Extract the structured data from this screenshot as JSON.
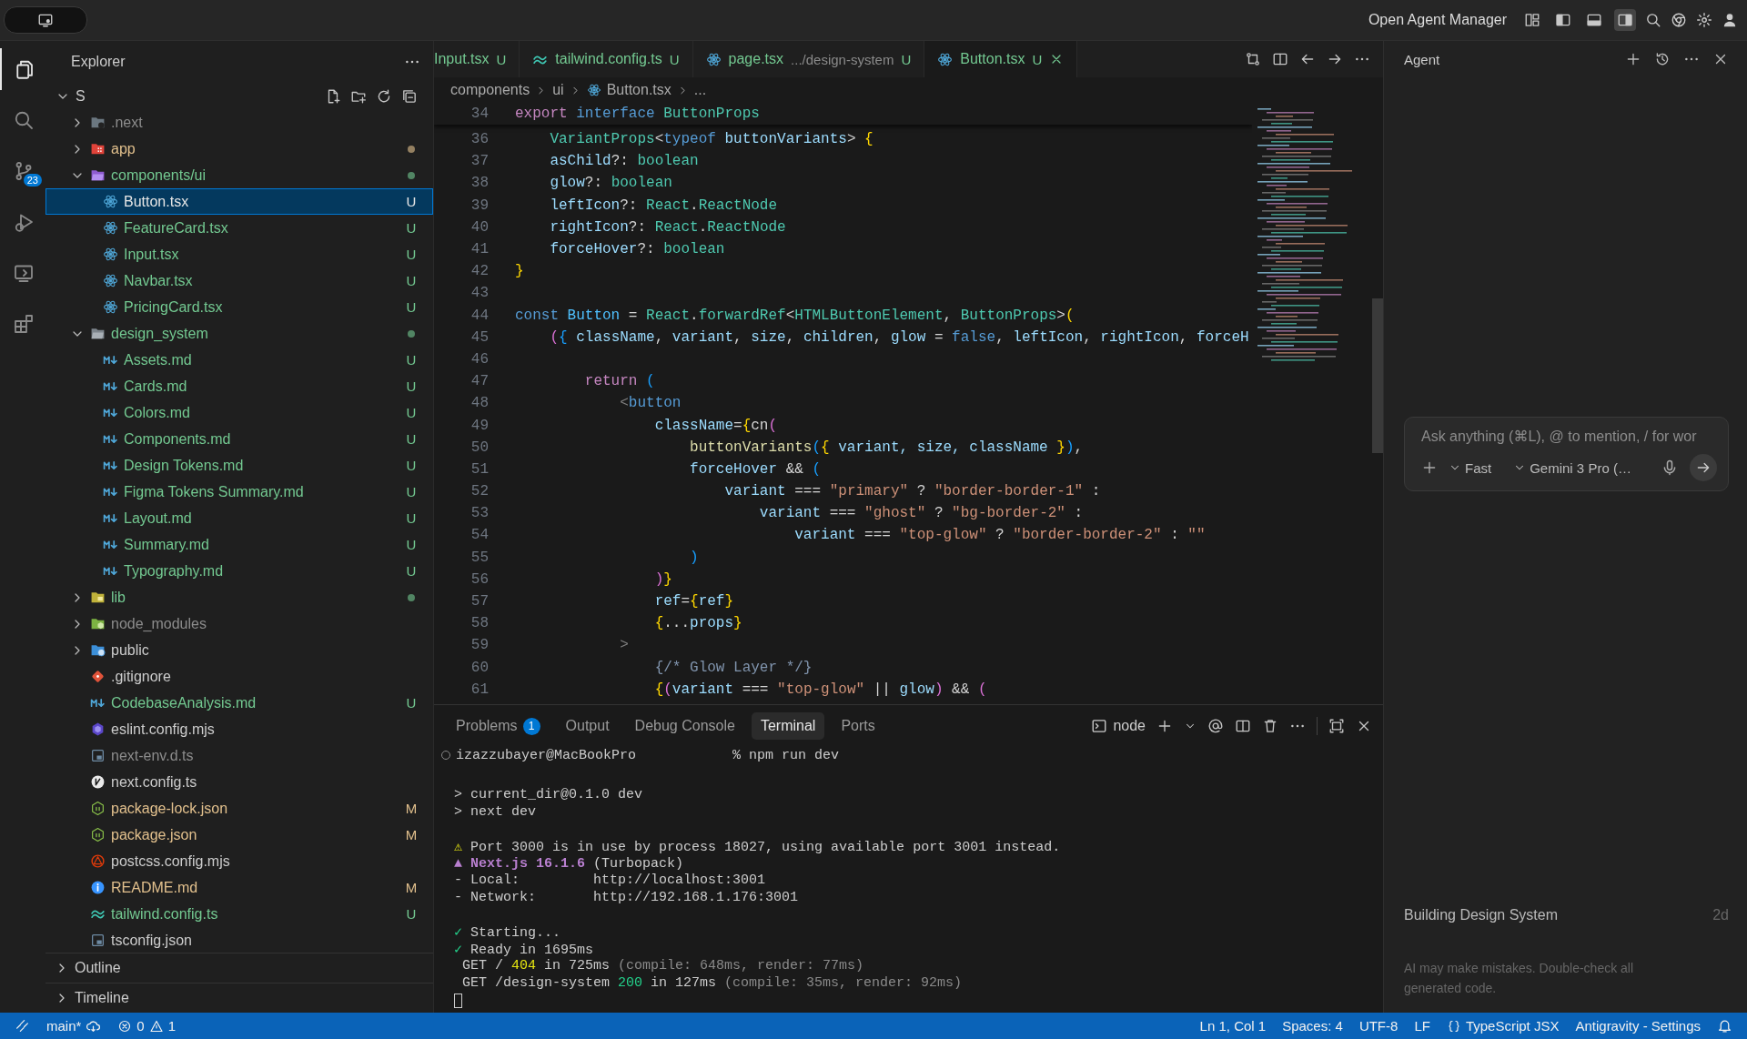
{
  "top_bar": {
    "agent_manager": "Open Agent Manager",
    "toggles": [
      {
        "kind": "customize",
        "selected": false
      },
      {
        "kind": "left-sidebar",
        "selected": false
      },
      {
        "kind": "panel",
        "selected": false
      },
      {
        "kind": "right-sidebar",
        "selected": true
      }
    ]
  },
  "activity_bar": [
    {
      "kind": "files",
      "selected": true
    },
    {
      "kind": "search",
      "selected": false
    },
    {
      "kind": "source-control",
      "selected": false,
      "badge": "23"
    },
    {
      "kind": "run",
      "selected": false
    },
    {
      "kind": "remote",
      "selected": false
    },
    {
      "kind": "extensions",
      "selected": false
    }
  ],
  "explorer": {
    "title": "Explorer",
    "root": {
      "name": "S",
      "kind": "root",
      "color": "#cccccc",
      "expanded": true,
      "selected": false,
      "children": [
        {
          "name": ".next",
          "kind": "nextfolder",
          "color": "#8c8c8c",
          "expanded": false,
          "selected": false
        },
        {
          "name": "app",
          "kind": "appfolder",
          "color": "#e2c08d",
          "dot": true,
          "expanded": false,
          "selected": false
        },
        {
          "name": "components/ui",
          "kind": "componentsfolder",
          "color": "#73c991",
          "dot": true,
          "expanded": true,
          "selected": false,
          "children": [
            {
              "name": "Button.tsx",
              "kind": "react",
              "color": "#e6e6e6",
              "badge": "U",
              "selected": true
            },
            {
              "name": "FeatureCard.tsx",
              "kind": "react",
              "color": "#73c991",
              "badge": "U",
              "selected": false
            },
            {
              "name": "Input.tsx",
              "kind": "react",
              "color": "#73c991",
              "badge": "U",
              "selected": false
            },
            {
              "name": "Navbar.tsx",
              "kind": "react",
              "color": "#73c991",
              "badge": "U",
              "selected": false
            },
            {
              "name": "PricingCard.tsx",
              "kind": "react",
              "color": "#73c991",
              "badge": "U",
              "selected": false
            }
          ]
        },
        {
          "name": "design_system",
          "kind": "plainfolder",
          "color": "#73c991",
          "dot": true,
          "expanded": true,
          "selected": false,
          "children": [
            {
              "name": "Assets.md",
              "kind": "markdown",
              "color": "#73c991",
              "badge": "U",
              "selected": false
            },
            {
              "name": "Cards.md",
              "kind": "markdown",
              "color": "#73c991",
              "badge": "U",
              "selected": false
            },
            {
              "name": "Colors.md",
              "kind": "markdown",
              "color": "#73c991",
              "badge": "U",
              "selected": false
            },
            {
              "name": "Components.md",
              "kind": "markdown",
              "color": "#73c991",
              "badge": "U",
              "selected": false
            },
            {
              "name": "Design Tokens.md",
              "kind": "markdown",
              "color": "#73c991",
              "badge": "U",
              "selected": false
            },
            {
              "name": "Figma Tokens Summary.md",
              "kind": "markdown",
              "color": "#73c991",
              "badge": "U",
              "selected": false
            },
            {
              "name": "Layout.md",
              "kind": "markdown",
              "color": "#73c991",
              "badge": "U",
              "selected": false
            },
            {
              "name": "Summary.md",
              "kind": "markdown",
              "color": "#73c991",
              "badge": "U",
              "selected": false
            },
            {
              "name": "Typography.md",
              "kind": "markdown",
              "color": "#73c991",
              "badge": "U",
              "selected": false
            }
          ]
        },
        {
          "name": "lib",
          "kind": "libfolder",
          "color": "#73c991",
          "dot": true,
          "expanded": false,
          "selected": false
        },
        {
          "name": "node_modules",
          "kind": "modulesfolder",
          "color": "#8c8c8c",
          "expanded": false,
          "selected": false
        },
        {
          "name": "public",
          "kind": "publicfolder",
          "color": "#cccccc",
          "expanded": false,
          "selected": false
        },
        {
          "name": ".gitignore",
          "kind": "git",
          "color": "#cccccc",
          "selected": false
        },
        {
          "name": "CodebaseAnalysis.md",
          "kind": "markdown",
          "color": "#73c991",
          "badge": "U",
          "selected": false
        },
        {
          "name": "eslint.config.mjs",
          "kind": "eslint",
          "color": "#cccccc",
          "selected": false
        },
        {
          "name": "next-env.d.ts",
          "kind": "typescript",
          "color": "#8c8c8c",
          "selected": false
        },
        {
          "name": "next.config.ts",
          "kind": "nextjs",
          "color": "#cccccc",
          "selected": false
        },
        {
          "name": "package-lock.json",
          "kind": "json",
          "color": "#e2c08d",
          "badge": "M",
          "selected": false
        },
        {
          "name": "package.json",
          "kind": "json",
          "color": "#e2c08d",
          "badge": "M",
          "selected": false
        },
        {
          "name": "postcss.config.mjs",
          "kind": "postcss",
          "color": "#cccccc",
          "selected": false
        },
        {
          "name": "README.md",
          "kind": "info",
          "color": "#e2c08d",
          "badge": "M",
          "selected": false
        },
        {
          "name": "tailwind.config.ts",
          "kind": "tailwind",
          "color": "#73c991",
          "badge": "U",
          "selected": false
        },
        {
          "name": "tsconfig.json",
          "kind": "typescript",
          "color": "#cccccc",
          "selected": false
        }
      ]
    },
    "sections": [
      {
        "label": "Outline",
        "expanded": false
      },
      {
        "label": "Timeline",
        "expanded": false
      }
    ]
  },
  "editor": {
    "tabs": [
      {
        "label": "Input.tsx",
        "kind": "hidden",
        "badge": "U",
        "selected": false
      },
      {
        "label": "tailwind.config.ts",
        "kind": "tailwind",
        "badge": "U",
        "selected": false
      },
      {
        "label": "page.tsx",
        "kind": "react",
        "description": ".../design-system",
        "badge": "U",
        "selected": false
      },
      {
        "label": "Button.tsx",
        "kind": "react",
        "badge": "U",
        "selected": true
      }
    ],
    "breadcrumb": [
      {
        "label": "components",
        "kind": "folder"
      },
      {
        "label": "ui",
        "kind": "folder"
      },
      {
        "label": "Button.tsx",
        "kind": "react"
      },
      {
        "label": "...",
        "kind": "symbol"
      }
    ],
    "sticky_line": {
      "number": "34",
      "tokens": [
        {
          "text": "export ",
          "kind": "keyword"
        },
        {
          "text": "interface ",
          "kind": "storage"
        },
        {
          "text": "ButtonProps",
          "kind": "type"
        }
      ]
    },
    "lines": [
      {
        "number": "36",
        "tokens": [
          {
            "text": "    VariantProps",
            "kind": "type"
          },
          {
            "text": "<",
            "kind": "plain"
          },
          {
            "text": "typeof ",
            "kind": "storage"
          },
          {
            "text": "buttonVariants",
            "kind": "variable"
          },
          {
            "text": "> ",
            "kind": "plain"
          },
          {
            "text": "{",
            "kind": "bracket1"
          }
        ]
      },
      {
        "number": "37",
        "tokens": [
          {
            "text": "    asChild",
            "kind": "variable"
          },
          {
            "text": "?: ",
            "kind": "plain"
          },
          {
            "text": "boolean",
            "kind": "type"
          }
        ]
      },
      {
        "number": "38",
        "tokens": [
          {
            "text": "    glow",
            "kind": "variable"
          },
          {
            "text": "?: ",
            "kind": "plain"
          },
          {
            "text": "boolean",
            "kind": "type"
          }
        ]
      },
      {
        "number": "39",
        "tokens": [
          {
            "text": "    leftIcon",
            "kind": "variable"
          },
          {
            "text": "?: ",
            "kind": "plain"
          },
          {
            "text": "React",
            "kind": "type"
          },
          {
            "text": ".",
            "kind": "plain"
          },
          {
            "text": "ReactNode",
            "kind": "type"
          }
        ]
      },
      {
        "number": "40",
        "tokens": [
          {
            "text": "    rightIcon",
            "kind": "variable"
          },
          {
            "text": "?: ",
            "kind": "plain"
          },
          {
            "text": "React",
            "kind": "type"
          },
          {
            "text": ".",
            "kind": "plain"
          },
          {
            "text": "ReactNode",
            "kind": "type"
          }
        ]
      },
      {
        "number": "41",
        "tokens": [
          {
            "text": "    forceHover",
            "kind": "variable"
          },
          {
            "text": "?: ",
            "kind": "plain"
          },
          {
            "text": "boolean",
            "kind": "type"
          }
        ]
      },
      {
        "number": "42",
        "tokens": [
          {
            "text": "}",
            "kind": "bracket1"
          }
        ]
      },
      {
        "number": "43"
      },
      {
        "number": "44",
        "tokens": [
          {
            "text": "const ",
            "kind": "storage"
          },
          {
            "text": "Button",
            "kind": "constant"
          },
          {
            "text": " = ",
            "kind": "plain"
          },
          {
            "text": "React",
            "kind": "type"
          },
          {
            "text": ".",
            "kind": "plain"
          },
          {
            "text": "forwardRef",
            "kind": "type"
          },
          {
            "text": "<",
            "kind": "plain"
          },
          {
            "text": "HTMLButtonElement",
            "kind": "type"
          },
          {
            "text": ", ",
            "kind": "plain"
          },
          {
            "text": "ButtonProps",
            "kind": "type"
          },
          {
            "text": ">",
            "kind": "plain"
          },
          {
            "text": "(",
            "kind": "bracket1"
          }
        ]
      },
      {
        "number": "45",
        "tokens": [
          {
            "text": "    (",
            "kind": "bracket2"
          },
          {
            "text": "{ ",
            "kind": "bracket3"
          },
          {
            "text": "className",
            "kind": "variable"
          },
          {
            "text": ", ",
            "kind": "plain"
          },
          {
            "text": "variant",
            "kind": "variable"
          },
          {
            "text": ", ",
            "kind": "plain"
          },
          {
            "text": "size",
            "kind": "variable"
          },
          {
            "text": ", ",
            "kind": "plain"
          },
          {
            "text": "children",
            "kind": "variable"
          },
          {
            "text": ", ",
            "kind": "plain"
          },
          {
            "text": "glow",
            "kind": "variable"
          },
          {
            "text": " = ",
            "kind": "plain"
          },
          {
            "text": "false",
            "kind": "storage"
          },
          {
            "text": ", ",
            "kind": "plain"
          },
          {
            "text": "leftIcon",
            "kind": "variable"
          },
          {
            "text": ", ",
            "kind": "plain"
          },
          {
            "text": "rightIcon",
            "kind": "variable"
          },
          {
            "text": ", ",
            "kind": "plain"
          },
          {
            "text": "forceH",
            "kind": "variable"
          }
        ]
      },
      {
        "number": "46"
      },
      {
        "number": "47",
        "tokens": [
          {
            "text": "        return ",
            "kind": "keyword"
          },
          {
            "text": "(",
            "kind": "bracket3"
          }
        ]
      },
      {
        "number": "48",
        "tokens": [
          {
            "text": "            <",
            "kind": "muted"
          },
          {
            "text": "button",
            "kind": "storage"
          }
        ]
      },
      {
        "number": "49",
        "tokens": [
          {
            "text": "                className",
            "kind": "variable"
          },
          {
            "text": "=",
            "kind": "plain"
          },
          {
            "text": "{",
            "kind": "bracket1"
          },
          {
            "text": "cn",
            "kind": "plain"
          },
          {
            "text": "(",
            "kind": "bracket2"
          }
        ]
      },
      {
        "number": "50",
        "tokens": [
          {
            "text": "                    buttonVariants",
            "kind": "function"
          },
          {
            "text": "(",
            "kind": "bracket3"
          },
          {
            "text": "{ ",
            "kind": "bracket1"
          },
          {
            "text": "variant, size, className ",
            "kind": "variable"
          },
          {
            "text": "}",
            "kind": "bracket1"
          },
          {
            "text": ")",
            "kind": "bracket3"
          },
          {
            "text": ",",
            "kind": "plain"
          }
        ]
      },
      {
        "number": "51",
        "tokens": [
          {
            "text": "                    forceHover",
            "kind": "variable"
          },
          {
            "text": " && ",
            "kind": "plain"
          },
          {
            "text": "(",
            "kind": "bracket3"
          }
        ]
      },
      {
        "number": "52",
        "tokens": [
          {
            "text": "                        variant",
            "kind": "variable"
          },
          {
            "text": " === ",
            "kind": "plain"
          },
          {
            "text": "\"primary\"",
            "kind": "string"
          },
          {
            "text": " ? ",
            "kind": "plain"
          },
          {
            "text": "\"border-border-1\"",
            "kind": "string"
          },
          {
            "text": " :",
            "kind": "plain"
          }
        ]
      },
      {
        "number": "53",
        "tokens": [
          {
            "text": "                            variant",
            "kind": "variable"
          },
          {
            "text": " === ",
            "kind": "plain"
          },
          {
            "text": "\"ghost\"",
            "kind": "string"
          },
          {
            "text": " ? ",
            "kind": "plain"
          },
          {
            "text": "\"bg-border-2\"",
            "kind": "string"
          },
          {
            "text": " :",
            "kind": "plain"
          }
        ]
      },
      {
        "number": "54",
        "tokens": [
          {
            "text": "                                variant",
            "kind": "variable"
          },
          {
            "text": " === ",
            "kind": "plain"
          },
          {
            "text": "\"top-glow\"",
            "kind": "string"
          },
          {
            "text": " ? ",
            "kind": "plain"
          },
          {
            "text": "\"border-border-2\"",
            "kind": "string"
          },
          {
            "text": " : ",
            "kind": "plain"
          },
          {
            "text": "\"\"",
            "kind": "string"
          }
        ]
      },
      {
        "number": "55",
        "tokens": [
          {
            "text": "                    )",
            "kind": "bracket3"
          }
        ]
      },
      {
        "number": "56",
        "tokens": [
          {
            "text": "                )",
            "kind": "bracket2"
          },
          {
            "text": "}",
            "kind": "bracket1"
          }
        ]
      },
      {
        "number": "57",
        "tokens": [
          {
            "text": "                ref",
            "kind": "variable"
          },
          {
            "text": "=",
            "kind": "plain"
          },
          {
            "text": "{",
            "kind": "bracket1"
          },
          {
            "text": "ref",
            "kind": "variable"
          },
          {
            "text": "}",
            "kind": "bracket1"
          }
        ]
      },
      {
        "number": "58",
        "tokens": [
          {
            "text": "                {",
            "kind": "bracket1"
          },
          {
            "text": "...",
            "kind": "plain"
          },
          {
            "text": "props",
            "kind": "variable"
          },
          {
            "text": "}",
            "kind": "bracket1"
          }
        ]
      },
      {
        "number": "59",
        "tokens": [
          {
            "text": "            >",
            "kind": "muted"
          }
        ]
      },
      {
        "number": "60",
        "tokens": [
          {
            "text": "                {/* Glow Layer */}",
            "kind": "comment"
          }
        ]
      },
      {
        "number": "61",
        "tokens": [
          {
            "text": "                {",
            "kind": "bracket1"
          },
          {
            "text": "(",
            "kind": "bracket2"
          },
          {
            "text": "variant",
            "kind": "variable"
          },
          {
            "text": " === ",
            "kind": "plain"
          },
          {
            "text": "\"top-glow\"",
            "kind": "string"
          },
          {
            "text": " || ",
            "kind": "plain"
          },
          {
            "text": "glow",
            "kind": "variable"
          },
          {
            "text": ")",
            "kind": "bracket2"
          },
          {
            "text": " && ",
            "kind": "plain"
          },
          {
            "text": "(",
            "kind": "bracket2"
          }
        ]
      }
    ]
  },
  "panel": {
    "tabs": [
      {
        "label": "Problems",
        "badge": "1",
        "selected": false
      },
      {
        "label": "Output",
        "selected": false
      },
      {
        "label": "Debug Console",
        "selected": false
      },
      {
        "label": "Terminal",
        "selected": true
      },
      {
        "label": "Ports",
        "selected": false
      }
    ],
    "terminal_name": "node",
    "prompt": {
      "user": "izazzubayer@MacBookPro",
      "command": "% npm run dev"
    },
    "terminal_lines": [
      {
        "kind": "blank"
      },
      {
        "kind": "output",
        "tokens": [
          {
            "text": "> current_dir@0.1.0 dev",
            "kind": "plain"
          }
        ]
      },
      {
        "kind": "output",
        "tokens": [
          {
            "text": "> next dev",
            "kind": "plain"
          }
        ]
      },
      {
        "kind": "blank"
      },
      {
        "kind": "output",
        "tokens": [
          {
            "text": "⚠ ",
            "kind": "warn"
          },
          {
            "text": "Port 3000 is in use by process 18027, using available port 3001 instead.",
            "kind": "plain"
          }
        ]
      },
      {
        "kind": "output",
        "tokens": [
          {
            "text": "▲ Next.js 16.1.6",
            "kind": "brand"
          },
          {
            "text": " (Turbopack)",
            "kind": "plain"
          }
        ]
      },
      {
        "kind": "output",
        "tokens": [
          {
            "text": "- Local:         http://localhost:3001",
            "kind": "plain"
          }
        ]
      },
      {
        "kind": "output",
        "tokens": [
          {
            "text": "- Network:       http://192.168.1.176:3001",
            "kind": "plain"
          }
        ]
      },
      {
        "kind": "blank"
      },
      {
        "kind": "output",
        "tokens": [
          {
            "text": "✓ ",
            "kind": "success"
          },
          {
            "text": "Starting...",
            "kind": "plain"
          }
        ]
      },
      {
        "kind": "output",
        "tokens": [
          {
            "text": "✓ ",
            "kind": "success"
          },
          {
            "text": "Ready in 1695ms",
            "kind": "plain"
          }
        ]
      },
      {
        "kind": "output",
        "tokens": [
          {
            "text": " GET / ",
            "kind": "plain"
          },
          {
            "text": "404",
            "kind": "warn"
          },
          {
            "text": " in 725ms ",
            "kind": "plain"
          },
          {
            "text": "(compile: 648ms, render: 77ms)",
            "kind": "dim"
          }
        ]
      },
      {
        "kind": "output",
        "tokens": [
          {
            "text": " GET /design-system ",
            "kind": "plain"
          },
          {
            "text": "200",
            "kind": "success"
          },
          {
            "text": " in 127ms ",
            "kind": "plain"
          },
          {
            "text": "(compile: 35ms, render: 92ms)",
            "kind": "dim"
          }
        ]
      },
      {
        "kind": "cursor"
      }
    ]
  },
  "agent": {
    "title": "Agent",
    "input": {
      "placeholder": "Ask anything (⌘L), @ to mention, / for wor"
    },
    "mode": "Fast",
    "model": "Gemini 3 Pro (…",
    "history": [
      {
        "title": "Building Design System",
        "age": "2d"
      }
    ],
    "disclaimer": "AI may make mistakes. Double-check all generated code."
  },
  "status_bar": {
    "branch": "main*",
    "errors": "0",
    "warnings": "1",
    "items": [
      "Ln 1, Col 1",
      "Spaces: 4",
      "UTF-8",
      "LF"
    ],
    "language": "TypeScript JSX",
    "settings": "Antigravity - Settings"
  }
}
